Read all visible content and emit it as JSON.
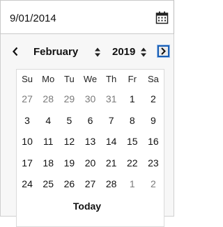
{
  "date_input": {
    "value": "9/01/2014",
    "icon": "calendar-icon"
  },
  "calendar": {
    "month": "February",
    "year": "2019",
    "prev_icon": "chevron-left-icon",
    "next_icon": "chevron-right-icon",
    "weekdays": [
      "Su",
      "Mo",
      "Tu",
      "We",
      "Th",
      "Fr",
      "Sa"
    ],
    "weeks": [
      [
        "27",
        "28",
        "29",
        "30",
        "31",
        "1",
        "2"
      ],
      [
        "3",
        "4",
        "5",
        "6",
        "7",
        "8",
        "9"
      ],
      [
        "10",
        "11",
        "12",
        "13",
        "14",
        "15",
        "16"
      ],
      [
        "17",
        "18",
        "19",
        "20",
        "21",
        "22",
        "23"
      ],
      [
        "24",
        "25",
        "26",
        "27",
        "28",
        "1",
        "2"
      ]
    ],
    "outside_month": [
      [
        true,
        true,
        true,
        true,
        true,
        false,
        false
      ],
      [
        false,
        false,
        false,
        false,
        false,
        false,
        false
      ],
      [
        false,
        false,
        false,
        false,
        false,
        false,
        false
      ],
      [
        false,
        false,
        false,
        false,
        false,
        false,
        false
      ],
      [
        false,
        false,
        false,
        false,
        false,
        true,
        true
      ]
    ],
    "today_label": "Today"
  },
  "colors": {
    "focus": "#1a5fb4",
    "muted_day": "#7a7a7a"
  }
}
